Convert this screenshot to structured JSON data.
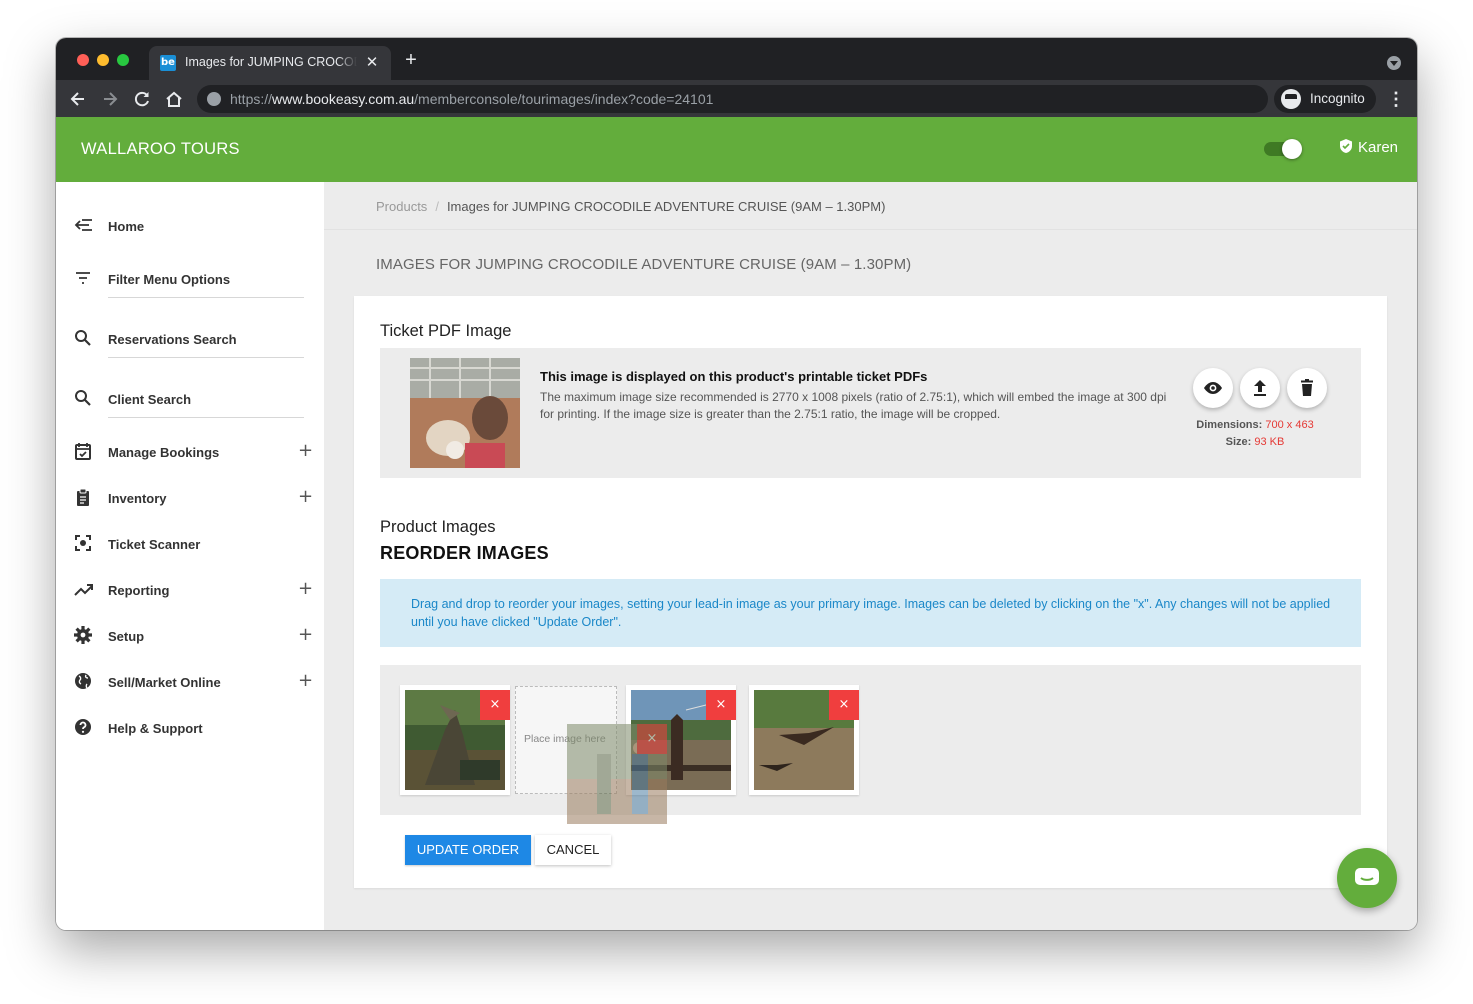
{
  "browser": {
    "tab_title": "Images for JUMPING CROCODILE ADVENTURE CRUISE (9AM – 1.30PM)",
    "tab_favicon_text": "be",
    "url_scheme": "https://",
    "url_host": "www.bookeasy.com.au",
    "url_path": "/memberconsole/tourimages/index?code=24101",
    "incognito_label": "Incognito"
  },
  "header": {
    "brand": "WALLAROO TOURS",
    "user_name": "Karen",
    "accent_color": "#63ad3c"
  },
  "sidebar": {
    "items": [
      {
        "label": "Home",
        "icon": "menu-collapse-icon",
        "expandable": false,
        "underline": false
      },
      {
        "label": "Filter Menu Options",
        "icon": "filter-icon",
        "expandable": false,
        "underline": true
      },
      {
        "label": "Reservations Search",
        "icon": "search-icon",
        "expandable": false,
        "underline": true
      },
      {
        "label": "Client Search",
        "icon": "search-icon",
        "expandable": false,
        "underline": true
      },
      {
        "label": "Manage Bookings",
        "icon": "calendar-check-icon",
        "expandable": true,
        "underline": false
      },
      {
        "label": "Inventory",
        "icon": "clipboard-icon",
        "expandable": true,
        "underline": false
      },
      {
        "label": "Ticket Scanner",
        "icon": "scan-icon",
        "expandable": false,
        "underline": false
      },
      {
        "label": "Reporting",
        "icon": "trending-up-icon",
        "expandable": true,
        "underline": false
      },
      {
        "label": "Setup",
        "icon": "gear-icon",
        "expandable": true,
        "underline": false
      },
      {
        "label": "Sell/Market Online",
        "icon": "globe-icon",
        "expandable": true,
        "underline": false
      },
      {
        "label": "Help & Support",
        "icon": "help-icon",
        "expandable": false,
        "underline": false
      }
    ]
  },
  "breadcrumb": {
    "root": "Products",
    "separator": "/",
    "current": "Images for JUMPING CROCODILE ADVENTURE CRUISE (9AM – 1.30PM)"
  },
  "page": {
    "title": "IMAGES FOR JUMPING CROCODILE ADVENTURE CRUISE (9AM – 1.30PM)"
  },
  "ticket_pdf": {
    "section_title": "Ticket PDF Image",
    "heading": "This image is displayed on this product's printable ticket PDFs",
    "description": "The maximum image size recommended is 2770 x 1008 pixels (ratio of 2.75:1), which will embed the image at 300 dpi for printing. If the image size is greater than the 2.75:1 ratio, the image will be cropped.",
    "dimensions_label": "Dimensions:",
    "dimensions_value": "700 x 463",
    "size_label": "Size:",
    "size_value": "93 KB",
    "actions": [
      "eye-icon",
      "upload-icon",
      "trash-icon"
    ]
  },
  "product_images": {
    "section_title": "Product Images",
    "reorder_title": "REORDER IMAGES",
    "instructions": "Drag and drop to reorder your images, setting your lead-in image as your primary image. Images can be deleted by clicking on the \"x\". Any changes will not be applied until you have clicked \"Update Order\".",
    "delete_glyph": "×",
    "placeholder_text": "Place image here",
    "update_label": "UPDATE ORDER",
    "cancel_label": "CANCEL",
    "primary_button_color": "#1e88e5",
    "delete_color": "#f03e3e"
  }
}
